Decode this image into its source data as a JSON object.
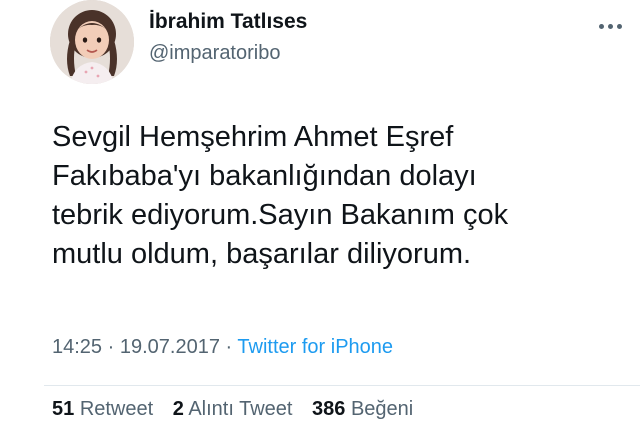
{
  "user": {
    "display_name": "İbrahim Tatlıses",
    "handle": "@imparatoribo",
    "avatar_icon": "avatar-child-photo"
  },
  "tweet": {
    "text_lines": [
      "Sevgil Hemşehrim Ahmet Eşref",
      "Fakıbaba'yı bakanlığından dolayı",
      "tebrik ediyorum.Sayın Bakanım çok",
      "mutlu oldum, başarılar diliyorum."
    ],
    "time": "14:25",
    "date": "19.07.2017",
    "separator": "·",
    "source": "Twitter for iPhone"
  },
  "stats": {
    "retweets": {
      "count": "51",
      "label": "Retweet"
    },
    "quotes": {
      "count": "2",
      "label": "Alıntı Tweet"
    },
    "likes": {
      "count": "386",
      "label": "Beğeni"
    }
  },
  "icons": {
    "more": "more-horizontal-icon"
  },
  "colors": {
    "text": "#0f1419",
    "secondary": "#536471",
    "link": "#1d9bf0"
  }
}
